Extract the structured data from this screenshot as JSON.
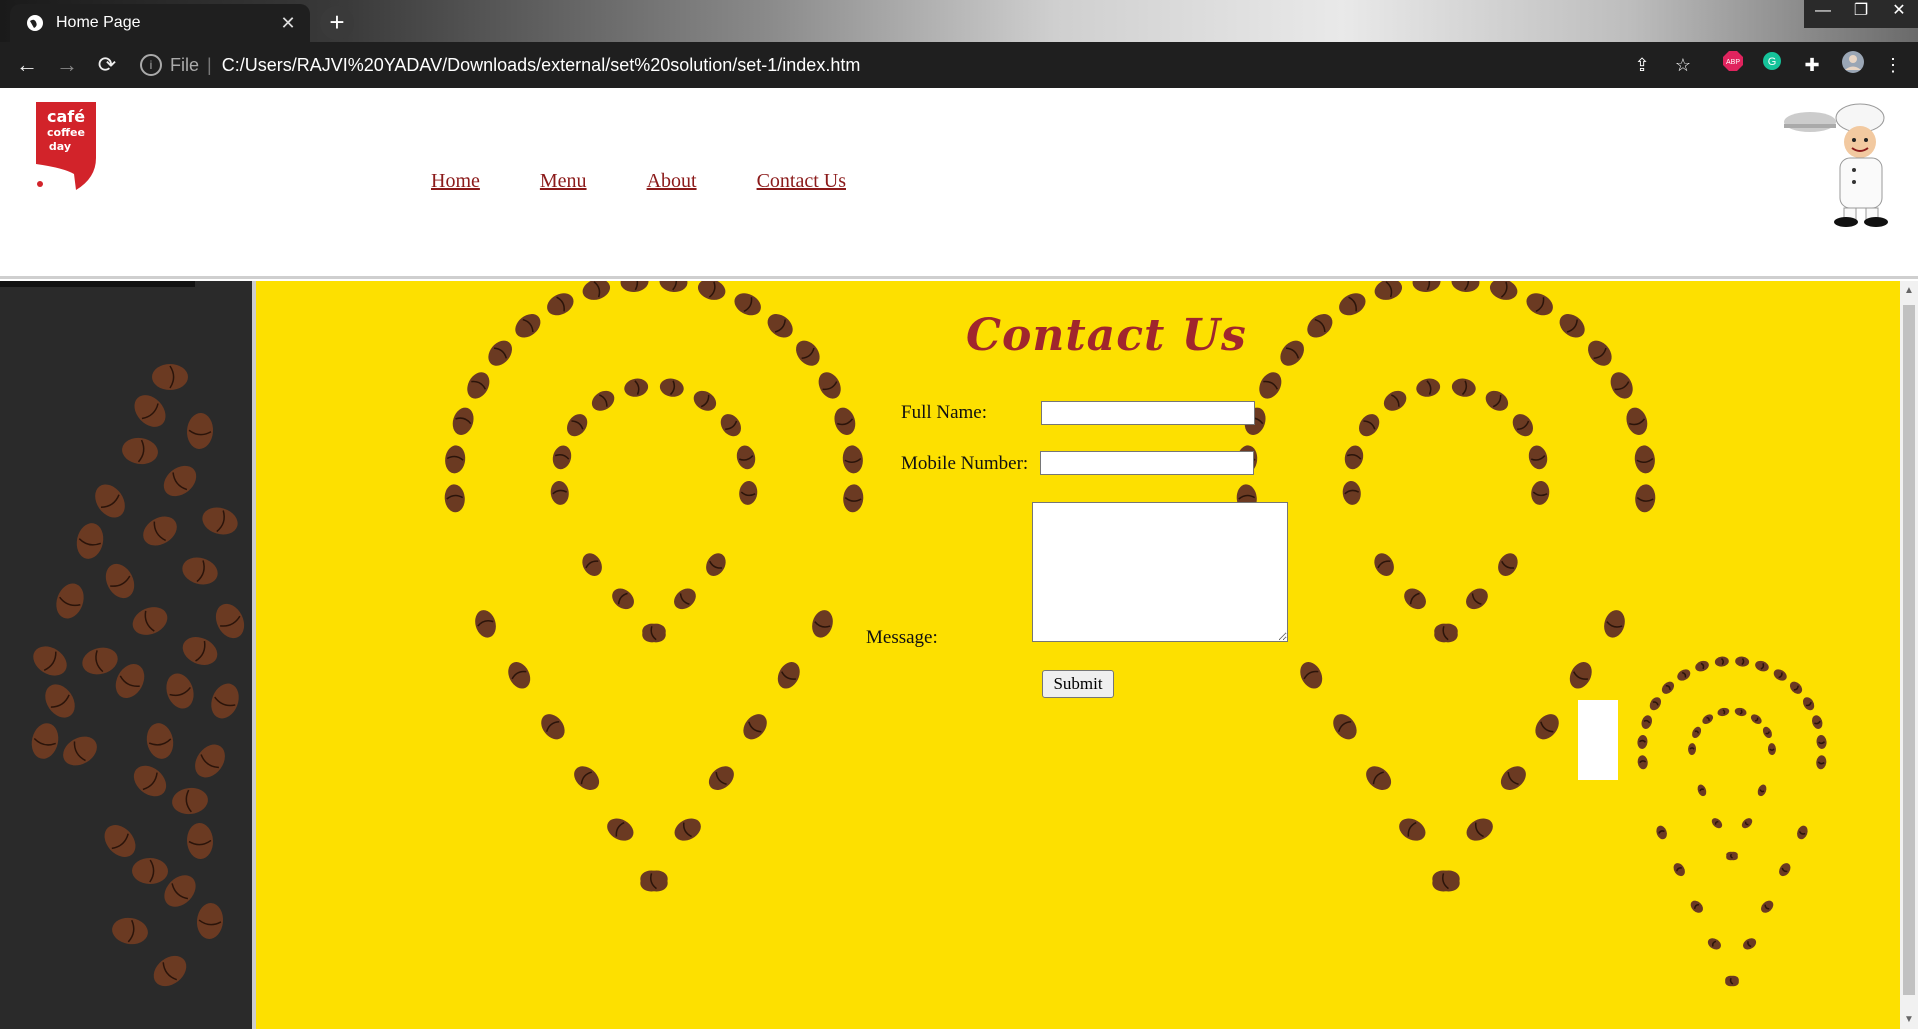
{
  "browser": {
    "tab_title": "Home Page",
    "tab_close": "✕",
    "new_tab": "+",
    "window_controls": [
      "—",
      "❐",
      "✕"
    ],
    "url_prefix": "File",
    "url_separator": "|",
    "url": "C:/Users/RAJVI%20YADAV/Downloads/external/set%20solution/set-1/index.htm",
    "extensions": [
      "share-icon",
      "star-icon",
      "abp-icon",
      "grammarly-icon",
      "puzzle-icon",
      "avatar",
      "kebab-menu-icon"
    ]
  },
  "header": {
    "logo_text": [
      "café",
      "coffee",
      "day"
    ],
    "nav": [
      "Home",
      "Menu",
      "About",
      "Contact Us"
    ]
  },
  "form": {
    "heading": "Contact Us",
    "full_name_label": "Full Name:",
    "mobile_label": "Mobile Number:",
    "message_label": "Message:",
    "full_name_value": "",
    "mobile_value": "",
    "message_value": "",
    "submit_label": "Submit"
  },
  "colors": {
    "page_background": "#fde000",
    "heading": "#a0262d",
    "link": "#8b1a1a",
    "side_panel": "#2a2a2a",
    "bean": "#6b3a22"
  }
}
